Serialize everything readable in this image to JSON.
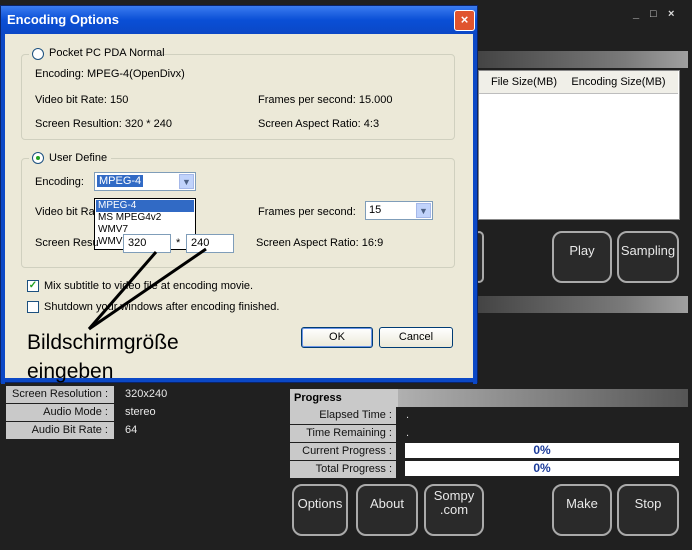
{
  "app": {
    "window_controls": {
      "minimize": "_",
      "maximize": "□",
      "close": "×"
    },
    "table": {
      "columns": [
        "File Size(MB)",
        "Encoding Size(MB)"
      ]
    },
    "buttons_mid": {
      "play": "Play",
      "sampling": "Sampling"
    },
    "info": {
      "rows": [
        {
          "label": "Screen Resolution :",
          "value": "320x240"
        },
        {
          "label": "Audio Mode :",
          "value": "stereo"
        },
        {
          "label": "Audio Bit Rate :",
          "value": "64"
        }
      ]
    },
    "progress": {
      "title": "Progress",
      "elapsed_label": "Elapsed Time :",
      "elapsed_value": ".",
      "remaining_label": "Time Remaining :",
      "remaining_value": ".",
      "current_label": "Current Progress :",
      "current_value": "0%",
      "current_fraction": 0,
      "total_label": "Total Progress :",
      "total_value": "0%",
      "total_fraction": 0
    },
    "buttons_bottom": {
      "options": "Options",
      "about": "About",
      "sompy_line1": "Sompy",
      "sompy_line2": ".com",
      "make": "Make",
      "stop": "Stop"
    }
  },
  "dialog": {
    "title": "Encoding Options",
    "close_glyph": "×",
    "preset": {
      "label": "Pocket PC PDA Normal",
      "selected": false,
      "encoding": "Encoding: MPEG-4(OpenDivx)",
      "video_bit_rate": "Video bit Rate: 150",
      "fps": "Frames per second: 15.000",
      "resolution": "Screen Resultion: 320 * 240",
      "aspect": "Screen Aspect Ratio: 4:3"
    },
    "user_define": {
      "label": "User Define",
      "selected": true,
      "encoding_label": "Encoding:",
      "encoding_value": "MPEG-4",
      "encoding_options": [
        "MPEG-4",
        "MS MPEG4v2",
        "WMV7",
        "WMV8"
      ],
      "video_bit_rate_label": "Video bit Ra",
      "fps_label": "Frames per second:",
      "fps_value": "15",
      "resolution_label": "Screen Resu",
      "width_value": "320",
      "x_sep": "*",
      "height_value": "240",
      "aspect": "Screen Aspect Ratio: 16:9"
    },
    "options": {
      "mix_subtitle": "Mix subtitle to video file at encoding movie.",
      "mix_subtitle_checked": true,
      "shutdown": "Shutdown your windows after encoding finished.",
      "shutdown_checked": false
    },
    "ok": "OK",
    "cancel": "Cancel"
  },
  "annotation": {
    "line1": "Bildschirmgröße",
    "line2": "eingeben"
  }
}
